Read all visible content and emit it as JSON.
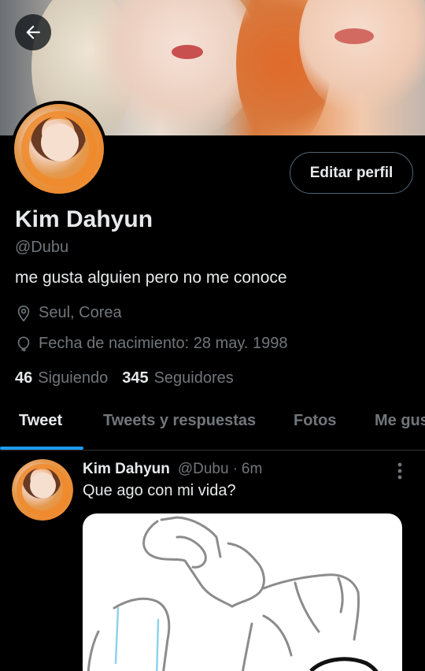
{
  "header": {
    "back_icon": "arrow-left-icon"
  },
  "profile": {
    "name": "Kim Dahyun",
    "handle": "@Dubu",
    "bio": "me gusta alguien pero no me conoce",
    "edit_button": "Editar perfil",
    "location": "Seul, Corea",
    "birthday": "Fecha de nacimiento: 28 may. 1998",
    "following_count": "46",
    "following_label": "Siguiendo",
    "followers_count": "345",
    "followers_label": "Seguidores"
  },
  "tabs": [
    {
      "label": "Tweet",
      "active": true
    },
    {
      "label": "Tweets y respuestas",
      "active": false
    },
    {
      "label": "Fotos",
      "active": false
    },
    {
      "label": "Me gusta",
      "active": false
    }
  ],
  "tweet": {
    "name": "Kim Dahyun",
    "handle": "@Dubu",
    "separator": "·",
    "time": "6m",
    "text": "Que ago con mi vida?",
    "more_icon": "more-vertical-icon"
  },
  "colors": {
    "background": "#000000",
    "primary_text": "#e7e9ea",
    "secondary_text": "#71767b",
    "accent": "#1d9bf0",
    "border": "#536471"
  }
}
